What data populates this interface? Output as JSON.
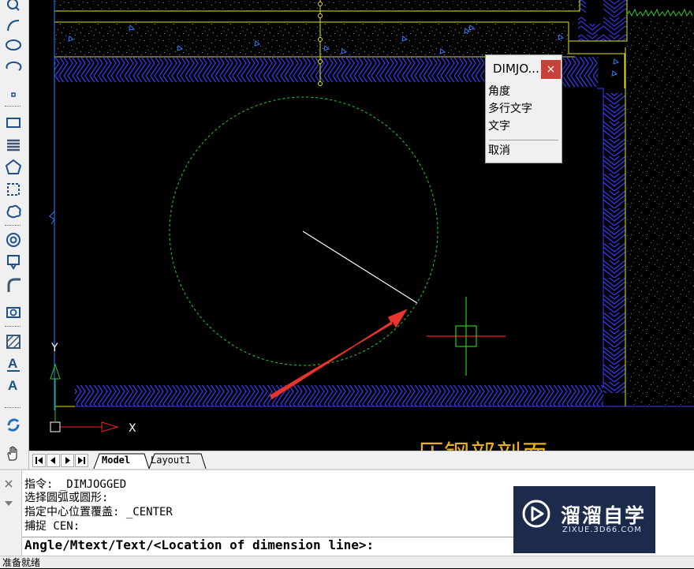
{
  "toolbar": {
    "tools": [
      "zoom-icon",
      "arc-icon",
      "ellipse-icon",
      "ellipse-arc-icon",
      "point-icon",
      "rectangle-icon",
      "spline-icon",
      "polygon-icon",
      "region-icon",
      "revision-cloud-icon",
      "donut-icon",
      "block-insert-icon",
      "fillet-icon",
      "table-icon",
      "hatch-icon",
      "mtext-icon",
      "text-icon",
      "refresh-icon",
      "pan-hand-icon"
    ]
  },
  "canvas": {
    "ucs_y": "Y",
    "ucs_x": "X",
    "bottom_title": "·压钢部剖面",
    "colors": {
      "wall": "#3b3bff",
      "border": "#e6e600",
      "circle": "#20c020",
      "crosshair_red": "#ff1e1e",
      "crosshair_green": "#1ed21e",
      "arrow": "#e8342a"
    }
  },
  "context_menu": {
    "title": "DIMJO...",
    "close": "×",
    "items": [
      "角度",
      "多行文字",
      "文字"
    ],
    "cancel": "取消"
  },
  "tabs": {
    "model": "Model",
    "layout1": "Layout1"
  },
  "command": {
    "history": [
      "指令:  _DIMJOGGED",
      "选择圆弧或圆形:",
      "指定中心位置覆盖: _CENTER",
      "捕捉 CEN:"
    ],
    "prompt": "Angle/Mtext/Text/<Location of dimension line>:"
  },
  "watermark": {
    "brand": "溜溜自学",
    "url": "ZIXUE.3D66.COM"
  },
  "status": {
    "text": "准备就绪"
  }
}
